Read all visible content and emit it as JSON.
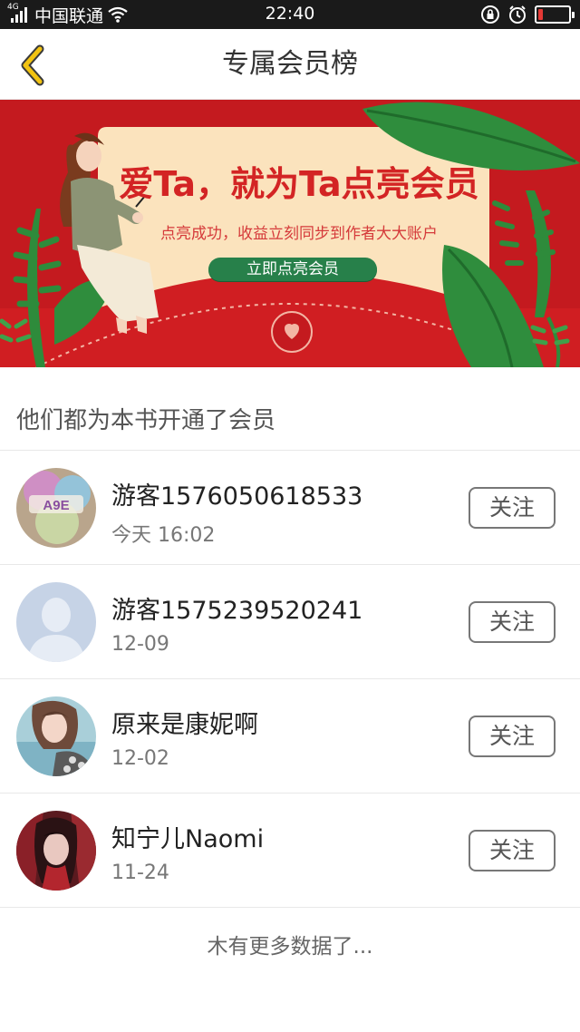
{
  "status_bar": {
    "network_tag": "4G",
    "carrier": "中国联通",
    "time": "22:40",
    "battery_level": 0.15,
    "battery_color": "#e53935"
  },
  "header": {
    "title": "专属会员榜",
    "back_icon": "chevron-left-icon",
    "accent_color": "#f2c311"
  },
  "banner": {
    "title": "爱Ta，就为Ta点亮会员",
    "subtitle": "点亮成功，收益立刻同步到作者大大账户",
    "button_label": "立即点亮会员"
  },
  "section": {
    "heading": "他们都为本书开通了会员"
  },
  "members": [
    {
      "name": "游客1576050618533",
      "time": "今天 16:02",
      "follow_label": "关注",
      "avatar": "colorful-avatar"
    },
    {
      "name": "游客1575239520241",
      "time": "12-09",
      "follow_label": "关注",
      "avatar": "default-avatar"
    },
    {
      "name": "原来是康妮啊",
      "time": "12-02",
      "follow_label": "关注",
      "avatar": "girl-avatar"
    },
    {
      "name": "知宁儿Naomi",
      "time": "11-24",
      "follow_label": "关注",
      "avatar": "red-portrait-avatar"
    }
  ],
  "footer": {
    "no_more_text": "木有更多数据了..."
  }
}
